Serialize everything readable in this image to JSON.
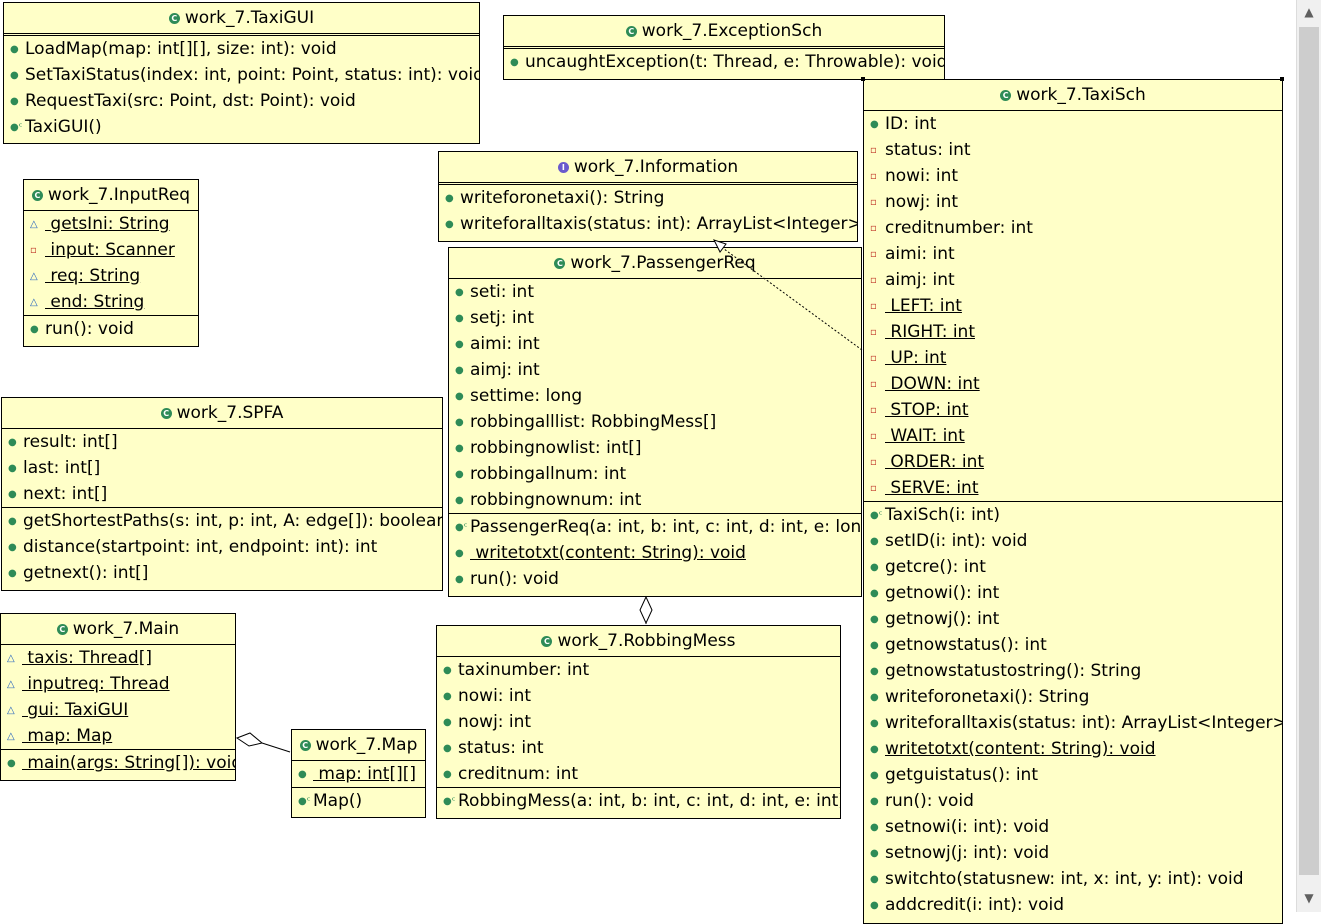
{
  "classes": {
    "taxigui": {
      "name": "work_7.TaxiGUI",
      "methods": [
        "LoadMap(map: int[][], size: int): void",
        "SetTaxiStatus(index: int, point: Point, status: int): void",
        "RequestTaxi(src: Point, dst: Point): void",
        "TaxiGUI()"
      ]
    },
    "exceptionsch": {
      "name": "work_7.ExceptionSch",
      "methods": [
        "uncaughtException(t: Thread, e: Throwable): void"
      ]
    },
    "inputreq": {
      "name": "work_7.InputReq",
      "fields": [
        " getsIni: String",
        " input: Scanner",
        " req: String",
        " end: String"
      ],
      "methods": [
        "run(): void"
      ]
    },
    "information": {
      "name": "work_7.Information",
      "methods": [
        "writeforonetaxi(): String",
        "writeforalltaxis(status: int): ArrayList<Integer>"
      ]
    },
    "passengerreq": {
      "name": "work_7.PassengerReq",
      "fields": [
        "seti: int",
        "setj: int",
        "aimi: int",
        "aimj: int",
        "settime: long",
        "robbingalllist: RobbingMess[]",
        "robbingnowlist: int[]",
        "robbingallnum: int",
        "robbingnownum: int"
      ],
      "methods": [
        "PassengerReq(a: int, b: int, c: int, d: int, e: long",
        " writetotxt(content: String): void",
        "run(): void"
      ]
    },
    "spfa": {
      "name": "work_7.SPFA",
      "fields": [
        "result: int[]",
        "last: int[]",
        "next: int[]"
      ],
      "methods": [
        "getShortestPaths(s: int, p: int, A: edge[]): boolean",
        "distance(startpoint: int, endpoint: int): int",
        "getnext(): int[]"
      ]
    },
    "main": {
      "name": "work_7.Main",
      "fields": [
        " taxis: Thread[]",
        " inputreq: Thread",
        " gui: TaxiGUI",
        " map: Map"
      ],
      "methods": [
        " main(args: String[]): void"
      ]
    },
    "map": {
      "name": "work_7.Map",
      "fields": [
        " map: int[][]"
      ],
      "methods": [
        "Map()"
      ]
    },
    "robbingmess": {
      "name": "work_7.RobbingMess",
      "fields": [
        "taxinumber: int",
        "nowi: int",
        "nowj: int",
        "status: int",
        "creditnum: int"
      ],
      "methods": [
        "RobbingMess(a: int, b: int, c: int, d: int, e: int)"
      ]
    },
    "taxisch": {
      "name": "work_7.TaxiSch",
      "fields": [
        "ID: int",
        "status: int",
        "nowi: int",
        "nowj: int",
        "creditnumber: int",
        "aimi: int",
        "aimj: int",
        " LEFT: int",
        " RIGHT: int",
        " UP: int",
        " DOWN: int",
        " STOP: int",
        " WAIT: int",
        " ORDER: int",
        " SERVE: int"
      ],
      "methods": [
        "TaxiSch(i: int)",
        "setID(i: int): void",
        "getcre(): int",
        "getnowi(): int",
        "getnowj(): int",
        "getnowstatus(): int",
        "getnowstatustostring(): String",
        "writeforonetaxi(): String",
        "writeforalltaxis(status: int): ArrayList<Integer>",
        "writetotxt(content: String): void",
        "getguistatus(): int",
        "run(): void",
        "setnowi(i: int): void",
        "setnowj(j: int): void",
        "switchto(statusnew: int, x: int, y: int): void",
        "addcredit(i: int): void"
      ]
    }
  },
  "colors": {
    "box_fill": "#ffffc8",
    "public": "#2e8b57",
    "private": "#c0392b",
    "package": "#1f5fbf"
  }
}
